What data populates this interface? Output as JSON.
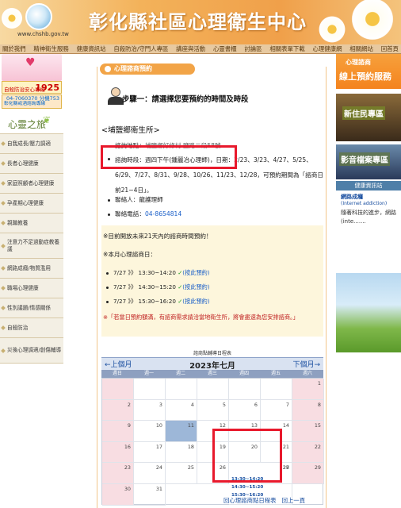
{
  "header": {
    "site_url": "www.chshb.gov.tw",
    "site_title": "彰化縣社區心理衛生中心"
  },
  "nav": {
    "items": [
      "關於我們",
      "精神衛生服務",
      "健康資訊站",
      "自殺防治/守門人專區",
      "講座與活動",
      "心靈書櫃",
      "討論區",
      "相關表單下載",
      "心理健康網",
      "相關網站",
      "回首頁"
    ]
  },
  "left": {
    "hotline1": {
      "label": "自殺防治安心專線",
      "number": "1925"
    },
    "hotline2": {
      "label": "彰化縣戒酒諮詢專線",
      "number": "04-7060370 分機753"
    },
    "journey_title": "心靈之旅",
    "menu": [
      "自我成長/壓力調適",
      "長者心理健康",
      "家庭照顧者心理健康",
      "孕產期心理健康",
      "親職教養",
      "注意力不足過動症教養議",
      "網路成癮/物質濫用",
      "職場心理健康",
      "性別議題/情感關係",
      "自殺防治",
      "災後心理調適/創傷輔導"
    ]
  },
  "main": {
    "section_tab": "心理諮商預約",
    "step_title": "步驟一：請選擇您要預約的時間及時段",
    "clinic_name": "<埔鹽鄉衛生所>",
    "location_label": "諮詢地點：",
    "location_value": "埔鹽鄉好修村  鹽路二段58號",
    "time_label": "諮詢時段：週四下午(鍾麗冶心理師)，日期：2/23、3/23、4/27、5/25、6/29、7/27、8/31、9/28、10/26、11/23、12/28，可預約期間為「諮商日前21~4日」。",
    "contact": "聯絡人：龍護理師",
    "phone_label": "聯絡電話：",
    "phone_value": "04-8654814",
    "notice1": "※目前開放未來21天內的諮商時間預約！",
    "notice2": "※本月心理諮商日：",
    "slots": [
      {
        "date": "7/27 》》",
        "time": "13:30~14:20",
        "check": "✓",
        "link": "(按此預約)"
      },
      {
        "date": "7/27 》》",
        "time": "14:30~15:20",
        "check": "✓",
        "link": "(按此預約)"
      },
      {
        "date": "7/27 》》",
        "time": "15:30~16:20",
        "check": "✓",
        "link": "(按此預約)"
      }
    ],
    "warning": "※「若當日預約額滿，有諮商需求請洽當地衛生所，將會盡速為您安排諮商。」",
    "calendar": {
      "caption": "諮商點輔導日程表",
      "prev": "←上個月",
      "month": "2023年七月",
      "next": "下個月→",
      "dow": [
        "週日",
        "週一",
        "週二",
        "週三",
        "週四",
        "週五",
        "週六"
      ],
      "days": [
        "",
        "",
        "",
        "",
        "",
        "",
        "1",
        "2",
        "3",
        "4",
        "5",
        "6",
        "7",
        "8",
        "9",
        "10",
        "11",
        "12",
        "13",
        "14",
        "15",
        "16",
        "17",
        "18",
        "19",
        "20",
        "21",
        "22",
        "23",
        "24",
        "25",
        "26",
        "27",
        "28",
        "29",
        "30",
        "31"
      ],
      "slot_times": [
        "13:30~14:20",
        "14:30~15:20",
        "15:30~16:20"
      ]
    },
    "footer_links": [
      "回心理諮商點日程表",
      "回上一頁"
    ]
  },
  "right": {
    "banner1_a": "心理諮商",
    "banner1_b": "線上預約服務",
    "banner2": "新住民專區",
    "banner3": "影音檔案專區",
    "banner4": "健康資訊站",
    "article_title": "網路成癮",
    "article_sub": "(Internet addiction)",
    "article_desc": "隨著科技的進步，網路(inte......."
  }
}
